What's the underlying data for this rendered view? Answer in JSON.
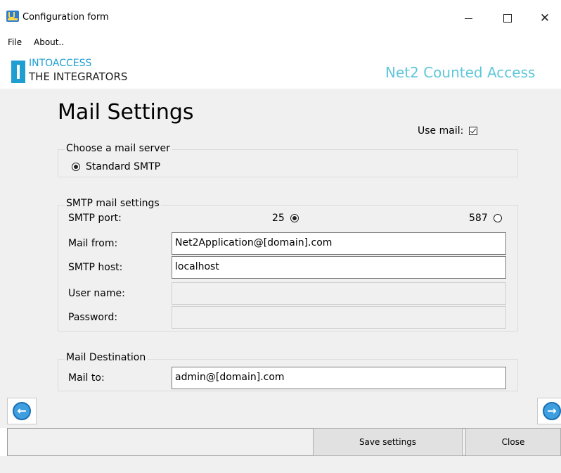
{
  "window": {
    "title": "Configuration form",
    "controls": {
      "minimize": "minimize",
      "maximize": "maximize",
      "close": "✕"
    }
  },
  "menu": {
    "items": [
      "File",
      "About.."
    ]
  },
  "header": {
    "logo_line1": "INTOACCESS",
    "logo_line2": "THE INTEGRATORS",
    "product": "Net2 Counted Access"
  },
  "page": {
    "title": "Mail Settings",
    "use_mail_label": "Use mail:",
    "use_mail_checked": true
  },
  "mail_server": {
    "group_title": "Choose a mail server",
    "option_label": "Standard SMTP",
    "selected": true
  },
  "smtp": {
    "group_title": "SMTP mail settings",
    "port_label": "SMTP port:",
    "port_options": [
      {
        "label": "25",
        "selected": true
      },
      {
        "label": "587",
        "selected": false
      }
    ],
    "mail_from_label": "Mail from:",
    "mail_from_value": "Net2Application@[domain].com",
    "host_label": "SMTP host:",
    "host_value": "localhost",
    "user_label": "User name:",
    "user_value": "",
    "password_label": "Password:",
    "password_value": ""
  },
  "destination": {
    "group_title": "Mail Destination",
    "mail_to_label": "Mail to:",
    "mail_to_value": "admin@[domain].com"
  },
  "navigation": {
    "back_icon": "arrow-left-circle",
    "next_icon": "arrow-right-circle"
  },
  "buttons": {
    "save": "Save settings",
    "close": "Close"
  },
  "colors": {
    "accent": "#1f9ed2",
    "product_text": "#5fc7d9",
    "background": "#f0f0f0"
  }
}
